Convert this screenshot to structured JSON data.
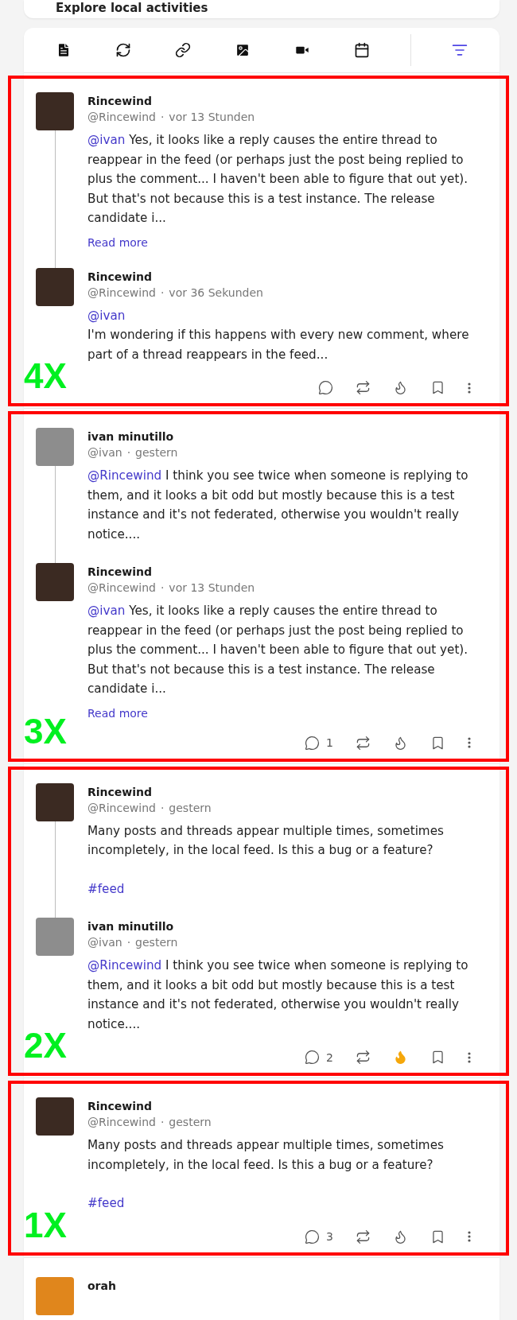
{
  "header_card": {
    "title": "Explore local activities"
  },
  "filter_bar": {
    "buttons": [
      {
        "kind": "text",
        "active": false
      },
      {
        "kind": "repost",
        "active": false
      },
      {
        "kind": "link",
        "active": false
      },
      {
        "kind": "image",
        "active": false
      },
      {
        "kind": "video",
        "active": false
      },
      {
        "kind": "event",
        "active": false
      },
      {
        "kind": "filter",
        "active": true
      }
    ]
  },
  "threads": [
    {
      "annotation": "4X",
      "posts": [
        {
          "author": "Rincewind",
          "handle": "@Rincewind",
          "dot": "·",
          "time": "vor 13 Stunden",
          "avatar": {
            "kind": "painted"
          },
          "paragraphs": [
            [
              {
                "kind": "mention",
                "text": "@ivan"
              },
              {
                "kind": "text",
                "text": " Yes, it looks like a reply causes the entire thread to reappear in the feed (or perhaps just the post being replied to plus the comment... I haven't been able to figure that out yet). But that's not because this is a test instance. The release candidate i..."
              }
            ]
          ],
          "read_more": "Read more"
        },
        {
          "author": "Rincewind",
          "handle": "@Rincewind",
          "dot": "·",
          "time": "vor 36 Sekunden",
          "avatar": {
            "kind": "painted"
          },
          "paragraphs": [
            [
              {
                "kind": "mention",
                "text": "@ivan"
              }
            ],
            [
              {
                "kind": "text",
                "text": "I'm wondering if this happens with every new comment, where part of a thread reappears in the feed..."
              }
            ]
          ]
        }
      ],
      "actions": {
        "reacted": false
      }
    },
    {
      "annotation": "3X",
      "posts": [
        {
          "author": "ivan minutillo",
          "handle": "@ivan",
          "dot": "·",
          "time": "gestern",
          "avatar": {
            "kind": "monochrome"
          },
          "paragraphs": [
            [
              {
                "kind": "mention",
                "text": "@Rincewind"
              },
              {
                "kind": "text",
                "text": " I think you see twice when someone is replying to them, and it looks a bit odd but mostly because this is a test instance and it's not federated, otherwise you wouldn't really notice...."
              }
            ]
          ]
        },
        {
          "author": "Rincewind",
          "handle": "@Rincewind",
          "dot": "·",
          "time": "vor 13 Stunden",
          "avatar": {
            "kind": "painted"
          },
          "paragraphs": [
            [
              {
                "kind": "mention",
                "text": "@ivan"
              },
              {
                "kind": "text",
                "text": " Yes, it looks like a reply causes the entire thread to reappear in the feed (or perhaps just the post being replied to plus the comment... I haven't been able to figure that out yet). But that's not because this is a test instance. The release candidate i..."
              }
            ]
          ],
          "read_more": "Read more"
        }
      ],
      "actions": {
        "comments": "1",
        "reacted": false
      }
    },
    {
      "annotation": "2X",
      "posts": [
        {
          "author": "Rincewind",
          "handle": "@Rincewind",
          "dot": "·",
          "time": "gestern",
          "avatar": {
            "kind": "painted"
          },
          "paragraphs": [
            [
              {
                "kind": "text",
                "text": "Many posts and threads appear multiple times, sometimes incompletely, in the local feed. Is this a bug or a feature?"
              }
            ],
            [
              {
                "kind": "hashtag",
                "text": "#feed"
              }
            ]
          ]
        },
        {
          "author": "ivan minutillo",
          "handle": "@ivan",
          "dot": "·",
          "time": "gestern",
          "avatar": {
            "kind": "monochrome"
          },
          "paragraphs": [
            [
              {
                "kind": "mention",
                "text": "@Rincewind"
              },
              {
                "kind": "text",
                "text": " I think you see twice when someone is replying to them, and it looks a bit odd but mostly because this is a test instance and it's not federated, otherwise you wouldn't really notice...."
              }
            ]
          ]
        }
      ],
      "actions": {
        "comments": "2",
        "reacted": true
      }
    },
    {
      "annotation": "1X",
      "posts": [
        {
          "author": "Rincewind",
          "handle": "@Rincewind",
          "dot": "·",
          "time": "gestern",
          "avatar": {
            "kind": "painted"
          },
          "paragraphs": [
            [
              {
                "kind": "text",
                "text": "Many posts and threads appear multiple times, sometimes incompletely, in the local feed. Is this a bug or a feature?"
              }
            ],
            [
              {
                "kind": "hashtag",
                "text": "#feed"
              }
            ]
          ]
        }
      ],
      "actions": {
        "comments": "3",
        "reacted": false
      }
    }
  ],
  "next_post": {
    "author": "orah",
    "avatar": {
      "kind": "orange"
    }
  }
}
